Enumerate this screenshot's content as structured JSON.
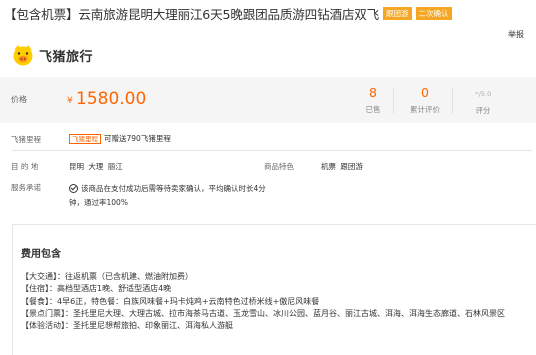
{
  "header": {
    "title": "【包含机票】云南旅游昆明大理丽江6天5晚跟团品质游四钻酒店双飞",
    "badges": [
      "跟团游",
      "二次确认"
    ],
    "report_label": "举报"
  },
  "brand": {
    "name": "飞猪旅行",
    "logo_icon": "fliggy-pig-icon",
    "accent": "#ffcc00"
  },
  "price": {
    "label": "价格",
    "currency": "¥",
    "value": "1580.00",
    "stats": [
      {
        "value": "8",
        "label": "已售"
      },
      {
        "value": "0",
        "label": "累计评价"
      },
      {
        "value": "-",
        "suffix": "/5.0",
        "label": "评分"
      }
    ]
  },
  "points": {
    "label": "飞猪里程",
    "tag": "飞猪里程",
    "text": "可赠送790飞猪里程"
  },
  "destination": {
    "label": "目 的 地",
    "value": "昆明  大理  丽江"
  },
  "features": {
    "label": "商品特色",
    "value": "机票  跟团游"
  },
  "service": {
    "label": "服务承诺",
    "icon": "check-circle-icon",
    "text": "该商品在支付成功后需等待卖家确认，平均确认时长4分钟，通过率100%"
  },
  "fees": {
    "title": "费用包含",
    "lines": [
      "【大交通】：往返机票（已含机建、燃油附加费）",
      "【住宿】：高档型酒店1晚、舒适型酒店4晚",
      "【餐食】：4早6正，特色餐：白族风味餐+玛卡炖鸡+云南特色过桥米线+傲尼风味餐",
      "【景点门票】：圣托里尼大理、大理古城、拉市海茶马古道、玉龙雪山、冰川公园、蓝月谷、丽江古城、洱海、洱海生态廊道、石林风景区",
      "【体验活动】：圣托里尼想帮旅拍、印象丽江、洱海私人游艇"
    ]
  },
  "colors": {
    "price": "#ff6600",
    "badge": "#f5a623",
    "panel": "#f5f5f5"
  }
}
